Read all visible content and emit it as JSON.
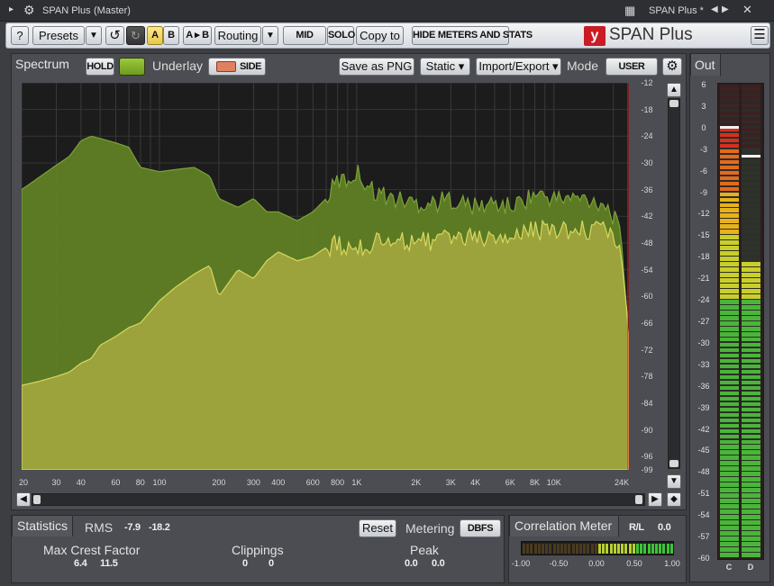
{
  "titlebar": {
    "plugin": "SPAN Plus",
    "track": "(Master)",
    "preset": "SPAN Plus *"
  },
  "toolbar": {
    "help": "?",
    "presets": "Presets",
    "menu_arrow": "▼",
    "ab_a": "A",
    "ab_b": "B",
    "atob": "A ▸ B",
    "routing": "Routing",
    "mid": "MID",
    "solo": "SOLO",
    "copy_to": "Copy to",
    "hide": "HIDE METERS AND STATS",
    "brand_mark": "y",
    "brand": "SPAN Plus"
  },
  "spectrum": {
    "title": "Spectrum",
    "hold": "HOLD",
    "underlay": "Underlay",
    "side": "SIDE",
    "save": "Save as PNG",
    "static": "Static ▾",
    "import": "Import/Export ▾",
    "mode_label": "Mode",
    "mode_value": "USER"
  },
  "chart_data": {
    "type": "area",
    "title": "",
    "xlabel": "",
    "ylabel": "",
    "x_scale": "log",
    "x_ticks": [
      "20",
      "30",
      "40",
      "60",
      "80",
      "100",
      "200",
      "300",
      "400",
      "600",
      "800",
      "1K",
      "2K",
      "3K",
      "4K",
      "6K",
      "8K",
      "10K",
      "24K"
    ],
    "y_ticks": [
      "-12",
      "-18",
      "-24",
      "-30",
      "-36",
      "-42",
      "-48",
      "-54",
      "-60",
      "-66",
      "-72",
      "-78",
      "-84",
      "-90",
      "-96",
      "-99"
    ],
    "xlim": [
      20,
      24000
    ],
    "ylim": [
      -99,
      -12
    ],
    "series": [
      {
        "role": "underlay",
        "color": "#5f7f24",
        "x": [
          20,
          25,
          30,
          35,
          40,
          45,
          50,
          60,
          70,
          80,
          100,
          120,
          150,
          180,
          200,
          250,
          300,
          350,
          400,
          500,
          600,
          700,
          800,
          900,
          1000,
          1200,
          1500,
          2000,
          2500,
          3000,
          4000,
          5000,
          6000,
          8000,
          10000,
          14000,
          18000,
          20000,
          22000,
          23000,
          24000
        ],
        "y": [
          -36,
          -33,
          -30.5,
          -28.5,
          -25,
          -24,
          -24.5,
          -25.5,
          -26.5,
          -31,
          -32,
          -31.5,
          -31,
          -33,
          -38,
          -40,
          -38,
          -41,
          -41,
          -43,
          -41,
          -38,
          -34,
          -34,
          -32,
          -36,
          -38,
          -39,
          -39,
          -38,
          -40,
          -39,
          -40,
          -37,
          -38,
          -38,
          -39,
          -42,
          -47,
          -58,
          -70
        ]
      },
      {
        "role": "main",
        "color": "#a2a63e",
        "x": [
          20,
          25,
          30,
          35,
          40,
          45,
          50,
          60,
          70,
          80,
          100,
          120,
          150,
          180,
          200,
          250,
          300,
          350,
          400,
          500,
          600,
          700,
          800,
          900,
          1000,
          1200,
          1500,
          2000,
          2500,
          3000,
          4000,
          5000,
          6000,
          8000,
          10000,
          14000,
          18000,
          20000,
          22000,
          23000,
          24000
        ],
        "y": [
          -80,
          -79,
          -78,
          -77,
          -75,
          -74,
          -71,
          -69,
          -67,
          -66,
          -61,
          -58,
          -55,
          -53,
          -60,
          -54,
          -56,
          -52,
          -50,
          -52,
          -51,
          -49,
          -48,
          -50,
          -49,
          -48,
          -48,
          -47.5,
          -47.5,
          -47,
          -47,
          -47,
          -46,
          -45,
          -45.5,
          -45,
          -45,
          -46,
          -50,
          -58,
          -70
        ]
      }
    ],
    "cursor_color": "#e02020"
  },
  "scroll": {
    "left": "◀",
    "right": "▶",
    "diamond": "◆",
    "up": "▲",
    "down": "▼"
  },
  "statistics": {
    "title": "Statistics",
    "rms_label": "RMS",
    "rms_l": "-7.9",
    "rms_r": "-18.2",
    "reset": "Reset",
    "metering": "Metering",
    "metering_value": "DBFS",
    "crest_label": "Max Crest Factor",
    "crest_l": "6.4",
    "crest_r": "11.5",
    "clip_label": "Clippings",
    "clip_l": "0",
    "clip_r": "0",
    "peak_label": "Peak",
    "peak_l": "0.0",
    "peak_r": "0.0"
  },
  "correlation": {
    "title": "Correlation Meter",
    "rl_label": "R/L",
    "rl_value": "0.0",
    "ticks": [
      "-1.00",
      "-0.50",
      "0.00",
      "0.50",
      "1.00"
    ],
    "active_from": 0.0,
    "active_to": 1.0
  },
  "out": {
    "title": "Out",
    "scale": [
      "6",
      "3",
      "0",
      "-3",
      "-6",
      "-9",
      "-12",
      "-15",
      "-18",
      "-21",
      "-24",
      "-27",
      "-30",
      "-33",
      "-36",
      "-39",
      "-42",
      "-45",
      "-48",
      "-51",
      "-54",
      "-57",
      "-60"
    ],
    "meter_c_label": "C",
    "meter_d_label": "D",
    "meter_c_level_db": 0,
    "meter_c_peak_db": 0,
    "meter_d_level_db": -18.5,
    "meter_d_peak_db": -4
  }
}
